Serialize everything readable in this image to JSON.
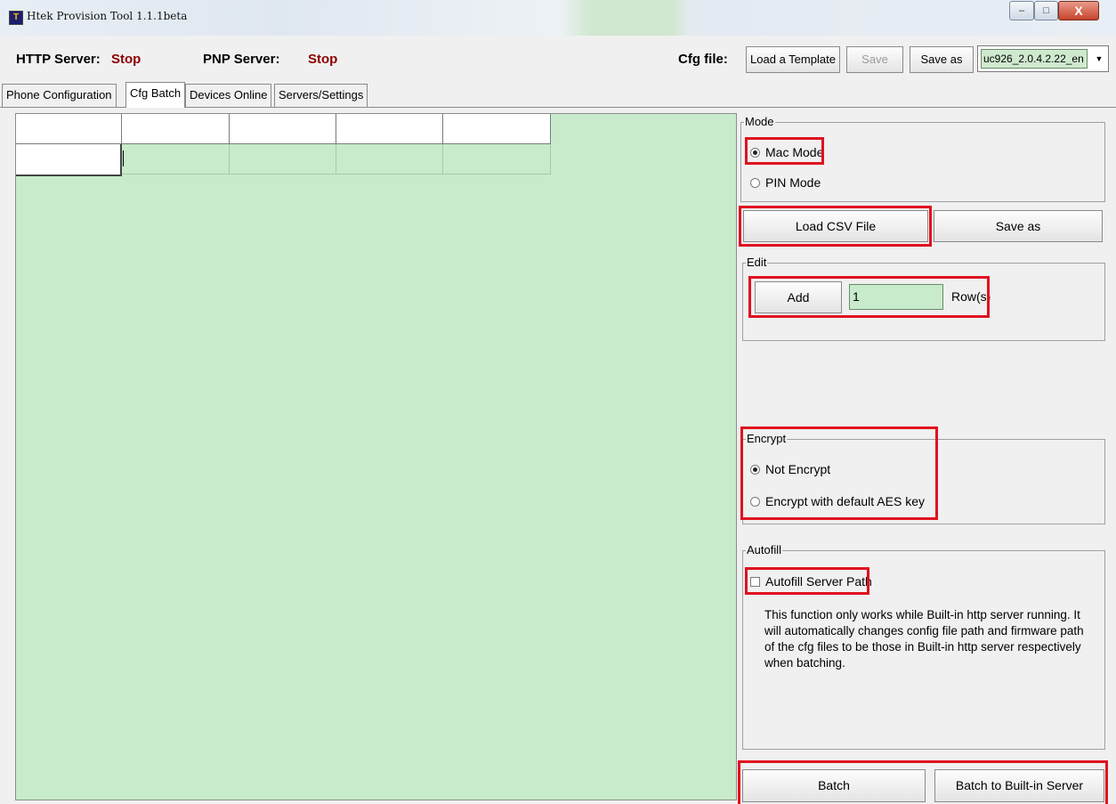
{
  "window": {
    "title": "Htek Provision Tool 1.1.1beta",
    "icon_text": "T",
    "controls": {
      "minimize": "–",
      "maximize": "□",
      "close": "X"
    }
  },
  "status_bar": {
    "http_server_label": "HTTP Server:",
    "http_server_status": "Stop",
    "pnp_server_label": "PNP Server:",
    "pnp_server_status": "Stop",
    "status_color": "#8b0000",
    "cfg_file_label": "Cfg file:",
    "load_template_label": "Load a Template",
    "save_label": "Save",
    "save_as_label": "Save as",
    "cfg_file_value": "uc926_2.0.4.2.22_en"
  },
  "tabs": [
    {
      "label": "Phone Configuration",
      "active": false
    },
    {
      "label": "Cfg Batch",
      "active": true
    },
    {
      "label": "Devices Online",
      "active": false
    },
    {
      "label": "Servers/Settings",
      "active": false
    }
  ],
  "grid": {
    "background": "#c7ebcb",
    "edit_row_value": ""
  },
  "mode": {
    "title": "Mode",
    "options": [
      {
        "label": "Mac Mode",
        "selected": true
      },
      {
        "label": "PIN Mode",
        "selected": false
      }
    ]
  },
  "csv": {
    "load_label": "Load CSV File",
    "save_as_label": "Save as"
  },
  "edit": {
    "title": "Edit",
    "add_label": "Add",
    "rows_value": "1",
    "rows_suffix": "Row(s)"
  },
  "encrypt": {
    "title": "Encrypt",
    "options": [
      {
        "label": "Not Encrypt",
        "selected": true
      },
      {
        "label": "Encrypt with default AES key",
        "selected": false
      }
    ]
  },
  "autofill": {
    "title": "Autofill",
    "checkbox_label": "Autofill Server Path",
    "checked": false,
    "description": "This function only works while Built-in http server running. It will automatically  changes config file path and firmware path of the cfg files to be those in Built-in http server respectively  when batching."
  },
  "actions": {
    "batch_label": "Batch",
    "batch_builtin_label": "Batch to Built-in Server"
  },
  "highlight_color": "#e0121f"
}
